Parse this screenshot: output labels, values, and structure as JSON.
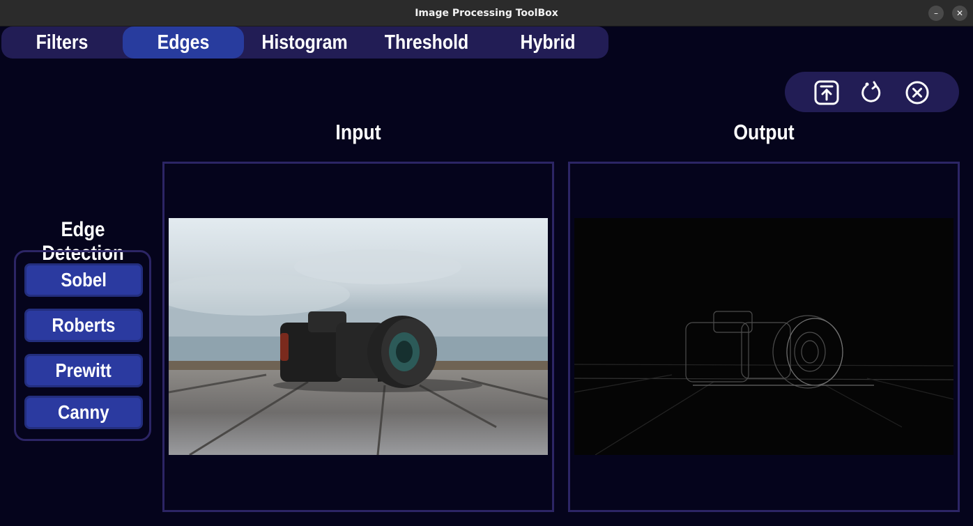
{
  "window": {
    "title": "Image Processing ToolBox",
    "minimize_glyph": "–",
    "close_glyph": "✕"
  },
  "tabs": [
    {
      "label": "Filters",
      "active": false
    },
    {
      "label": "Edges",
      "active": true
    },
    {
      "label": "Histogram",
      "active": false
    },
    {
      "label": "Threshold",
      "active": false
    },
    {
      "label": "Hybrid",
      "active": false
    }
  ],
  "toolbar": {
    "icons": [
      "upload-icon",
      "reset-icon",
      "close-circle-icon"
    ]
  },
  "input_panel": {
    "title": "Input"
  },
  "output_panel": {
    "title": "Output"
  },
  "edge_detection": {
    "title": "Edge Detection",
    "buttons": [
      {
        "label": "Sobel"
      },
      {
        "label": "Roberts"
      },
      {
        "label": "Prewitt"
      },
      {
        "label": "Canny"
      }
    ]
  },
  "colors": {
    "background": "#05041c",
    "panel": "#221d55",
    "active_tab": "#283c9e",
    "button": "#2b3aa0",
    "frame_border": "#2c2565"
  }
}
